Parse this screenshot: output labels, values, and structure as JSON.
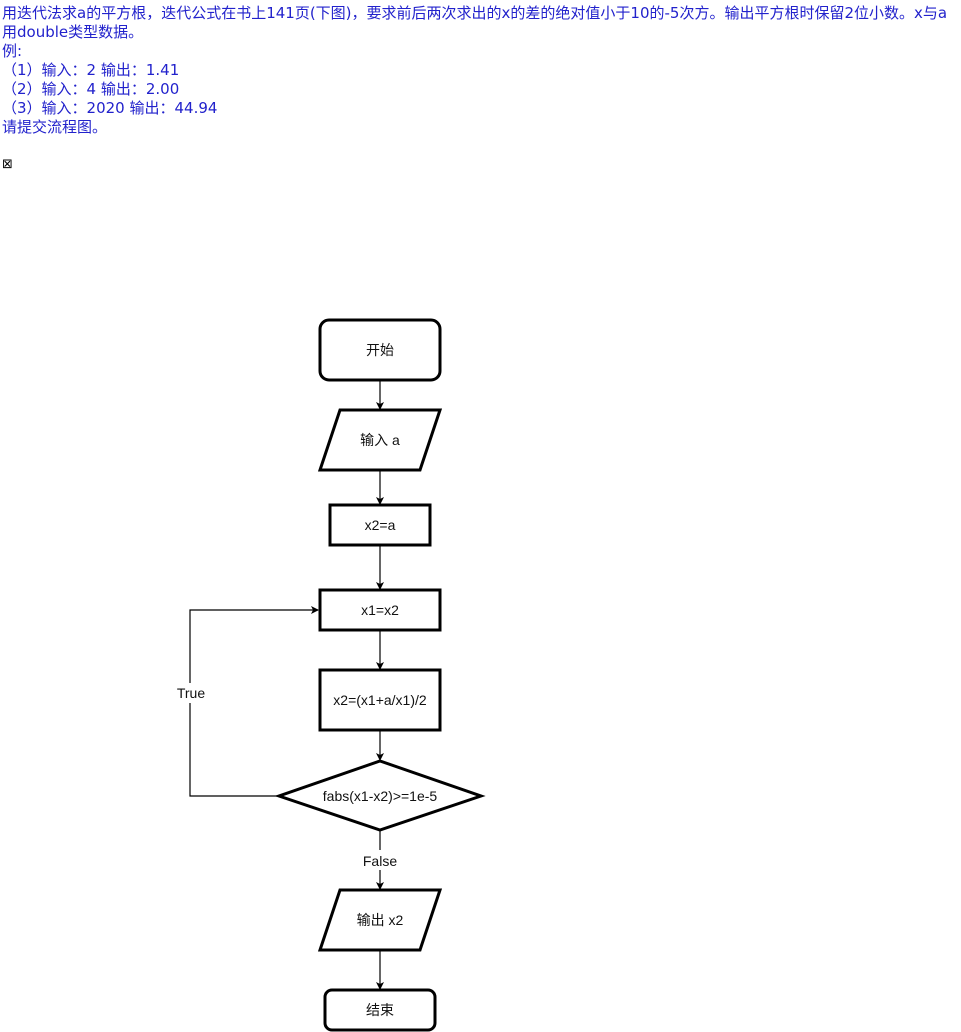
{
  "problem": {
    "lines": [
      "用迭代法求a的平方根，迭代公式在书上141页(下图)，要求前后两次求出的x的差的绝对值小于10的-5次方。输出平方根时保留2位小数。x与a用double类型数据。",
      "例:",
      "（1）输入：2 输出：1.41",
      "（2）输入：4 输出：2.00",
      "（3）输入：2020 输出：44.94",
      "请提交流程图。"
    ],
    "broken_image_glyph": "⊠"
  },
  "flowchart": {
    "start": "开始",
    "input": "输入 a",
    "init": "x2=a",
    "assign": "x1=x2",
    "iterate": "x2=(x1+a/x1)/2",
    "condition": "fabs(x1-x2)>=1e-5",
    "true_label": "True",
    "false_label": "False",
    "output": "输出 x2",
    "end": "结束"
  }
}
